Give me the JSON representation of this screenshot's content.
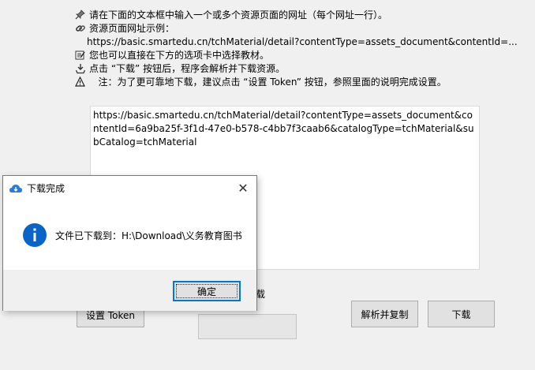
{
  "instructions": [
    {
      "icon": "pin-icon",
      "text": "请在下面的文本框中输入一个或多个资源页面的网址（每个网址一行）。"
    },
    {
      "icon": "link-icon",
      "text": "资源页面网址示例："
    },
    {
      "icon": "",
      "text": "https://basic.smartedu.cn/tchMaterial/detail?contentType=assets_document&contentId=..."
    },
    {
      "icon": "edit-icon",
      "text": "您也可以直接在下方的选项卡中选择教材。"
    },
    {
      "icon": "download-icon",
      "text": "点击 “下载” 按钮后，程序会解析并下载资源。"
    },
    {
      "icon": "warning-icon",
      "text": "   注：为了更可靠地下载，建议点击 “设置 Token” 按钮，参照里面的说明完成设置。"
    }
  ],
  "url_input": {
    "value": "https://basic.smartedu.cn/tchMaterial/detail?contentType=assets_document&contentId=6a9ba25f-3f1d-47e0-b578-c4bb7f3caab6&catalogType=tchMaterial&subCatalog=tchMaterial"
  },
  "buttons": {
    "set_token": "设置 Token",
    "parse_copy": "解析并复制",
    "download": "下载"
  },
  "partial_label": "载",
  "dialog": {
    "title": "下载完成",
    "message": "文件已下载到：H:\\Download\\义务教育图书",
    "ok": "确定",
    "close_glyph": "✕"
  },
  "colors": {
    "accent": "#0078d7",
    "info_blue": "#0a64c8"
  }
}
